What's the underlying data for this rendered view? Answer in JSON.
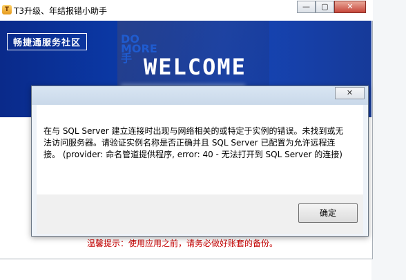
{
  "main_window": {
    "title": "T3升级、年结报错小助手",
    "buttons": {
      "minimize": "—",
      "maximize": "▢",
      "close": "✕"
    }
  },
  "banner": {
    "badge": "畅捷通服务社区",
    "tagline": "DO MORE 手",
    "welcome": "WELCOME"
  },
  "warning": "温馨提示：使用应用之前，请务必做好账套的备份。",
  "dialog": {
    "close": "✕",
    "message": "在与 SQL Server 建立连接时出现与网络相关的或特定于实例的错误。未找到或无法访问服务器。请验证实例名称是否正确并且 SQL Server 已配置为允许远程连接。 (provider: 命名管道提供程序, error: 40 - 无法打开到 SQL Server 的连接)",
    "ok_label": "确定"
  },
  "colors": {
    "banner": "#0b3aa8",
    "warning": "#c40000"
  }
}
